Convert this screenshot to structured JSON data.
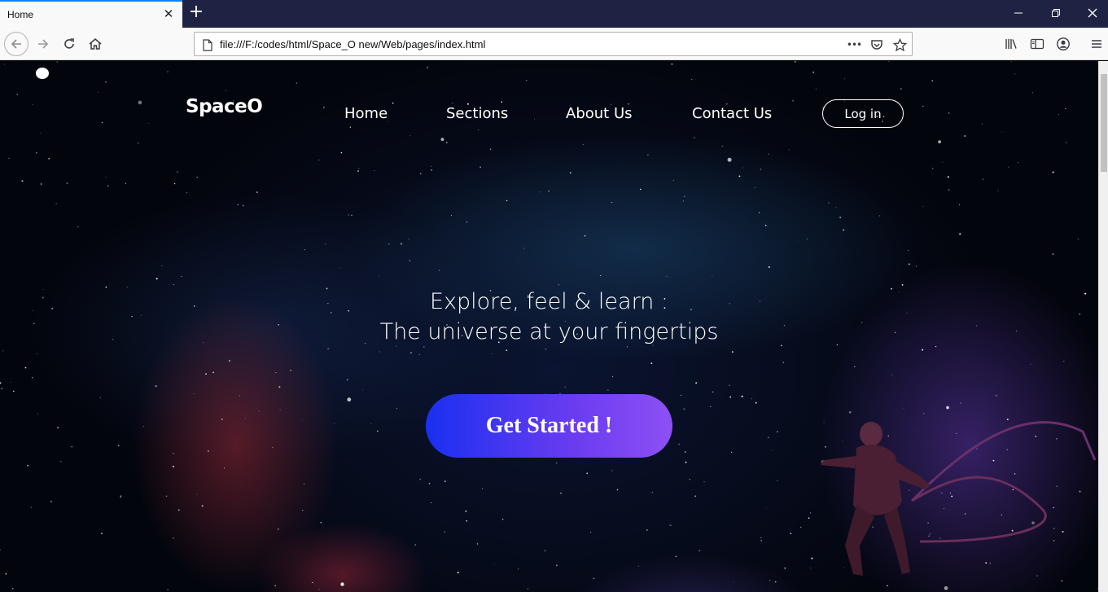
{
  "browser": {
    "tab_title": "Home",
    "tab_close": "✕",
    "new_tab": "+",
    "url": "file:///F:/codes/html/Space_O new/Web/pages/index.html",
    "page_actions": "•••",
    "accent": "#0a84ff"
  },
  "page": {
    "logo": "SpaceO",
    "nav": [
      {
        "label": "Home"
      },
      {
        "label": "Sections"
      },
      {
        "label": "About Us"
      },
      {
        "label": "Contact Us"
      }
    ],
    "login_label": "Log in",
    "headline_line1": "Explore, feel & learn :",
    "headline_line2": "The universe at your fingertips",
    "cta_label": "Get Started !",
    "cta_gradient": [
      "#1a30f0",
      "#8d50f5"
    ]
  }
}
